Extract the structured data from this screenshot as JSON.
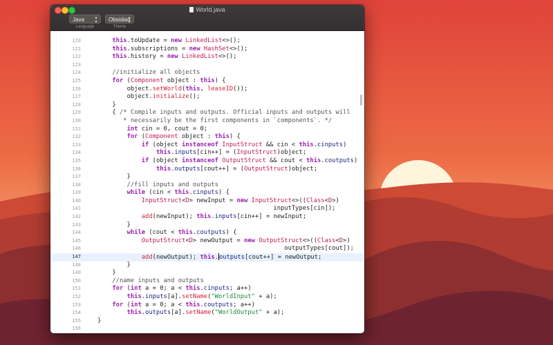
{
  "window": {
    "title": "World.java",
    "language": {
      "value": "Java",
      "caption": "Language"
    },
    "theme": {
      "value": "Obsidian",
      "caption": "Theme"
    }
  },
  "icons": {
    "close": "close-dot",
    "minimize": "minimize-dot",
    "maximize": "maximize-dot",
    "document": "document-icon",
    "chevron": "chevron-updown-icon"
  },
  "colors": {
    "keyword": "#9b1fb0",
    "type": "#c2185b",
    "field": "#1a237e",
    "method": "#d0233a",
    "string": "#1a8a3a",
    "comment": "#545454",
    "active_line": "#e8f2fe",
    "titlebar": "#363233"
  },
  "editor": {
    "active_line": 147,
    "lines": [
      {
        "n": "120",
        "t": "        this.toUpdate = new LinkedList<>();"
      },
      {
        "n": "121",
        "t": "        this.subscriptions = new HashSet<>();"
      },
      {
        "n": "122",
        "t": "        this.history = new LinkedList<>();"
      },
      {
        "n": "123",
        "t": ""
      },
      {
        "n": "124",
        "t": "        //initialize all objects"
      },
      {
        "n": "125",
        "t": "        for (Component object : this) {"
      },
      {
        "n": "126",
        "t": "            object.setWorld(this, leaseID());"
      },
      {
        "n": "127",
        "t": "            object.initialize();"
      },
      {
        "n": "128",
        "t": "        }"
      },
      {
        "n": "129",
        "t": "        { /* Compile inputs and outputs. Official inputs and outputs will"
      },
      {
        "n": "130",
        "t": "           * necessarily be the first components in `components`. */"
      },
      {
        "n": "131",
        "t": "            int cin = 0, cout = 0;"
      },
      {
        "n": "132",
        "t": "            for (Component object : this) {"
      },
      {
        "n": "133",
        "t": "                if (object instanceof InputStruct && cin < this.cinputs)"
      },
      {
        "n": "134",
        "t": "                    this.inputs[cin++] = (InputStruct)object;"
      },
      {
        "n": "135",
        "t": "                if (object instanceof OutputStruct && cout < this.coutputs)"
      },
      {
        "n": "136",
        "t": "                    this.outputs[cout++] = (OutputStruct)object;"
      },
      {
        "n": "137",
        "t": "            }"
      },
      {
        "n": "138",
        "t": "            //fill inputs and outputs"
      },
      {
        "n": "139",
        "t": "            while (cin < this.cinputs) {"
      },
      {
        "n": "140",
        "t": "                InputStruct<D> newInput = new InputStruct<>((Class<D>)"
      },
      {
        "n": "141",
        "t": "                                                    inputTypes[cin]);"
      },
      {
        "n": "142",
        "t": "                add(newInput); this.inputs[cin++] = newInput;"
      },
      {
        "n": "143",
        "t": "            }"
      },
      {
        "n": "144",
        "t": "            while (cout < this.coutputs) {"
      },
      {
        "n": "145",
        "t": "                OutputStruct<D> newOutput = new OutputStruct<>((Class<D>)"
      },
      {
        "n": "146",
        "t": "                                                       outputTypes[cout]);"
      },
      {
        "n": "147",
        "t": "                add(newOutput); this.outputs[cout++] = newOutput;"
      },
      {
        "n": "148",
        "t": "            }"
      },
      {
        "n": "149",
        "t": "        }"
      },
      {
        "n": "150",
        "t": "        //name inputs and outputs"
      },
      {
        "n": "151",
        "t": "        for (int a = 0; a < this.cinputs; a++)"
      },
      {
        "n": "152",
        "t": "            this.inputs[a].setName(\"WorldInput\" + a);"
      },
      {
        "n": "153",
        "t": "        for (int a = 0; a < this.coutputs; a++)"
      },
      {
        "n": "154",
        "t": "            this.outputs[a].setName(\"WorldOutput\" + a);"
      },
      {
        "n": "155",
        "t": "    }"
      },
      {
        "n": "156",
        "t": ""
      }
    ]
  }
}
